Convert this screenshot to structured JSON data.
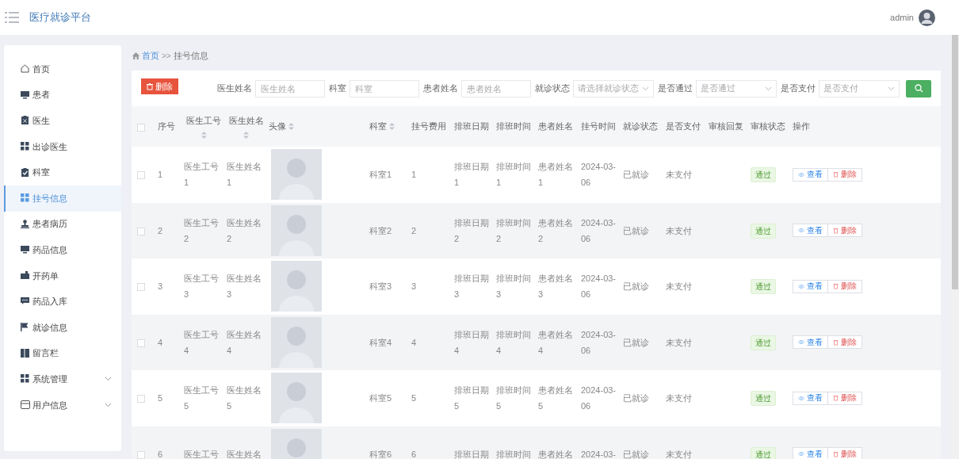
{
  "header": {
    "title": "医疗就诊平台",
    "user": "admin"
  },
  "sidebar": {
    "items": [
      {
        "label": "首页",
        "selected": false
      },
      {
        "label": "患者",
        "selected": false
      },
      {
        "label": "医生",
        "selected": false
      },
      {
        "label": "出诊医生",
        "selected": false
      },
      {
        "label": "科室",
        "selected": false
      },
      {
        "label": "挂号信息",
        "selected": true
      },
      {
        "label": "患者病历",
        "selected": false
      },
      {
        "label": "药品信息",
        "selected": false
      },
      {
        "label": "开药单",
        "selected": false
      },
      {
        "label": "药品入库",
        "selected": false
      },
      {
        "label": "就诊信息",
        "selected": false
      },
      {
        "label": "留言栏",
        "selected": false
      },
      {
        "label": "系统管理",
        "selected": false,
        "expandable": true
      },
      {
        "label": "用户信息",
        "selected": false,
        "expandable": true
      }
    ]
  },
  "breadcrumb": {
    "home": "首页",
    "separator": ">>",
    "current": "挂号信息"
  },
  "toolbar": {
    "delete_button": "删除",
    "filters": [
      {
        "label": "医生姓名",
        "placeholder": "医生姓名",
        "kind": "input"
      },
      {
        "label": "科室",
        "placeholder": "科室",
        "kind": "input"
      },
      {
        "label": "患者姓名",
        "placeholder": "患者姓名",
        "kind": "input"
      },
      {
        "label": "就诊状态",
        "placeholder": "请选择就诊状态",
        "kind": "select"
      },
      {
        "label": "是否通过",
        "placeholder": "是否通过",
        "kind": "select"
      },
      {
        "label": "是否支付",
        "placeholder": "是否支付",
        "kind": "select"
      }
    ]
  },
  "table": {
    "select_all_checked": false,
    "columns": [
      {
        "label": "序号",
        "kind": "text",
        "sortable": false
      },
      {
        "label": "医生工号",
        "kind": "text",
        "sortable": true
      },
      {
        "label": "医生姓名",
        "kind": "text",
        "sortable": true
      },
      {
        "label": "头像",
        "kind": "photo",
        "sortable": true
      },
      {
        "label": "科室",
        "kind": "text",
        "sortable": true
      },
      {
        "label": "挂号费用",
        "kind": "text",
        "sortable": false
      },
      {
        "label": "排班日期",
        "kind": "text",
        "sortable": false
      },
      {
        "label": "排班时间",
        "kind": "text",
        "sortable": false
      },
      {
        "label": "患者姓名",
        "kind": "text",
        "sortable": false
      },
      {
        "label": "挂号时间",
        "kind": "text",
        "sortable": false
      },
      {
        "label": "就诊状态",
        "kind": "text",
        "sortable": false
      },
      {
        "label": "是否支付",
        "kind": "text",
        "sortable": false
      },
      {
        "label": "审核回复",
        "kind": "text",
        "sortable": false
      },
      {
        "label": "审核状态",
        "kind": "tag",
        "sortable": false
      },
      {
        "label": "操作",
        "kind": "actions",
        "sortable": false
      }
    ],
    "rows": [
      {
        "checked": false,
        "cells": [
          "1",
          "医生工号 1",
          "医生姓名 1",
          "",
          "科室1",
          "1",
          "排班日期 1",
          "排班时间 1",
          "患者姓名 1",
          "2024-03- 06",
          "已就诊",
          "未支付",
          "",
          "通过"
        ],
        "view": "查看",
        "delete": "删除"
      },
      {
        "checked": false,
        "cells": [
          "2",
          "医生工号 2",
          "医生姓名 2",
          "",
          "科室2",
          "2",
          "排班日期 2",
          "排班时间 2",
          "患者姓名 2",
          "2024-03- 06",
          "已就诊",
          "未支付",
          "",
          "通过"
        ],
        "view": "查看",
        "delete": "删除"
      },
      {
        "checked": false,
        "cells": [
          "3",
          "医生工号 3",
          "医生姓名 3",
          "",
          "科室3",
          "3",
          "排班日期 3",
          "排班时间 3",
          "患者姓名 3",
          "2024-03- 06",
          "已就诊",
          "未支付",
          "",
          "通过"
        ],
        "view": "查看",
        "delete": "删除"
      },
      {
        "checked": false,
        "cells": [
          "4",
          "医生工号 4",
          "医生姓名 4",
          "",
          "科室4",
          "4",
          "排班日期 4",
          "排班时间 4",
          "患者姓名 4",
          "2024-03- 06",
          "已就诊",
          "未支付",
          "",
          "通过"
        ],
        "view": "查看",
        "delete": "删除"
      },
      {
        "checked": false,
        "cells": [
          "5",
          "医生工号 5",
          "医生姓名 5",
          "",
          "科室5",
          "5",
          "排班日期 5",
          "排班时间 5",
          "患者姓名 5",
          "2024-03- 06",
          "已就诊",
          "未支付",
          "",
          "通过"
        ],
        "view": "查看",
        "delete": "删除"
      },
      {
        "checked": false,
        "cells": [
          "6",
          "医生工号",
          "医生姓名",
          "",
          "科室6",
          "6",
          "排班日期",
          "排班时间",
          "患者姓名",
          "2024-03-",
          "已就诊",
          "未支付",
          "",
          "通过"
        ],
        "view": "查看",
        "delete": "删除"
      }
    ]
  }
}
